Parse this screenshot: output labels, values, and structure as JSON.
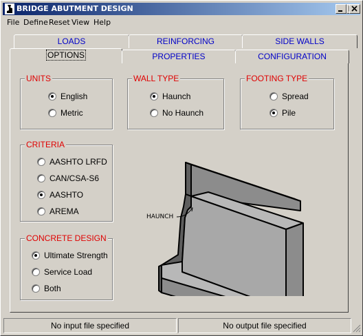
{
  "window": {
    "title": "BRIDGE ABUTMENT DESIGN"
  },
  "menu": [
    "File",
    "Define",
    "Reset",
    "View",
    "Help"
  ],
  "tabs_back": [
    "LOADS",
    "REINFORCING",
    "SIDE WALLS"
  ],
  "tabs_front": [
    "OPTIONS",
    "PROPERTIES",
    "CONFIGURATION"
  ],
  "groups": {
    "units": {
      "title": "UNITS",
      "options": [
        "English",
        "Metric"
      ],
      "selected": "English"
    },
    "wall_type": {
      "title": "WALL TYPE",
      "options": [
        "Haunch",
        "No Haunch"
      ],
      "selected": "Haunch"
    },
    "footing_type": {
      "title": "FOOTING TYPE",
      "options": [
        "Spread",
        "Pile"
      ],
      "selected": "Pile"
    },
    "criteria": {
      "title": "CRITERIA",
      "options": [
        "AASHTO LRFD",
        "CAN/CSA-S6",
        "AASHTO",
        "AREMA"
      ],
      "selected": "AASHTO"
    },
    "concrete_design": {
      "title": "CONCRETE DESIGN",
      "options": [
        "Ultimate Strength",
        "Service Load",
        "Both"
      ],
      "selected": "Ultimate Strength"
    }
  },
  "diagram": {
    "label": "HAUNCH"
  },
  "status": {
    "input": "No input file specified",
    "output": "No output file specified"
  },
  "colors": {
    "title_gradient_start": "#0a246a",
    "title_gradient_end": "#a6caf0",
    "group_title": "#e00000",
    "tab_text": "#0000c8"
  }
}
